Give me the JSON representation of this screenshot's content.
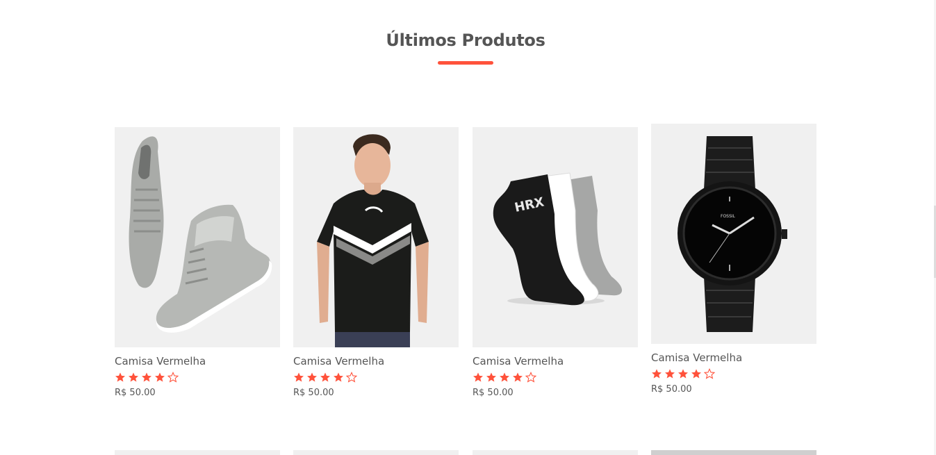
{
  "section": {
    "title": "Últimos Produtos"
  },
  "colors": {
    "accent": "#ff523b",
    "text": "#555555",
    "card_background": "#f0f0f0"
  },
  "products": [
    {
      "name": "Camisa Vermelha",
      "price": "R$ 50.00",
      "rating": 4,
      "rating_max": 5,
      "image": "grey-high-top-sneakers"
    },
    {
      "name": "Camisa Vermelha",
      "price": "R$ 50.00",
      "rating": 4,
      "rating_max": 5,
      "image": "black-puma-tshirt-model"
    },
    {
      "name": "Camisa Vermelha",
      "price": "R$ 50.00",
      "rating": 4,
      "rating_max": 5,
      "image": "hrx-ankle-socks-three-pairs"
    },
    {
      "name": "Camisa Vermelha",
      "price": "R$ 50.00",
      "rating": 4,
      "rating_max": 5,
      "image": "fossil-black-wristwatch"
    }
  ]
}
